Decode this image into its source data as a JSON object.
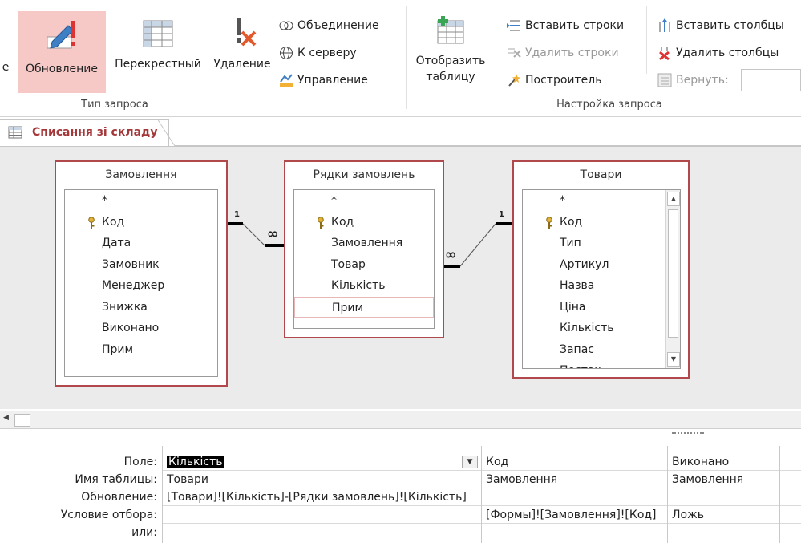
{
  "ribbon": {
    "buttons": {
      "update_partial": "е",
      "update": "Обновление",
      "crosstab": "Перекрестный",
      "delete": "Удаление",
      "show_table_line1": "Отобразить",
      "show_table_line2": "таблицу"
    },
    "small": {
      "union": "Объединение",
      "to_server": "К серверу",
      "manage": "Управление",
      "insert_rows": "Вставить строки",
      "delete_rows": "Удалить строки",
      "builder": "Построитель",
      "insert_cols": "Вставить столбцы",
      "delete_cols": "Удалить столбцы",
      "return": "Вернуть:"
    },
    "groups": {
      "query_type": "Тип запроса",
      "query_setup": "Настройка запроса"
    }
  },
  "tab": {
    "label": "Списання зі складу"
  },
  "tables": [
    {
      "title": "Замовлення",
      "fields": [
        "*",
        "Код",
        "Дата",
        "Замовник",
        "Менеджер",
        "Знижка",
        "Виконано",
        "Прим"
      ]
    },
    {
      "title": "Рядки замовлень",
      "fields": [
        "*",
        "Код",
        "Замовлення",
        "Товар",
        "Кількість",
        "Прим"
      ]
    },
    {
      "title": "Товари",
      "fields": [
        "*",
        "Код",
        "Тип",
        "Артикул",
        "Назва",
        "Ціна",
        "Кількість",
        "Запас",
        "Постач"
      ]
    }
  ],
  "relations": {
    "one": "1",
    "many": "∞"
  },
  "grid": {
    "row_labels": [
      "Поле:",
      "Имя таблицы:",
      "Обновление:",
      "Условие отбора:",
      "или:"
    ],
    "columns": [
      {
        "field": "Кількість",
        "table": "Товари",
        "update": "[Товари]![Кількість]-[Рядки замовлень]![Кількість]",
        "criteria": "",
        "or": ""
      },
      {
        "field": "Код",
        "table": "Замовлення",
        "update": "",
        "criteria": "[Формы]![Замовлення]![Код]",
        "or": ""
      },
      {
        "field": "Виконано",
        "table": "Замовлення",
        "update": "",
        "criteria": "Ложь",
        "or": ""
      }
    ]
  }
}
